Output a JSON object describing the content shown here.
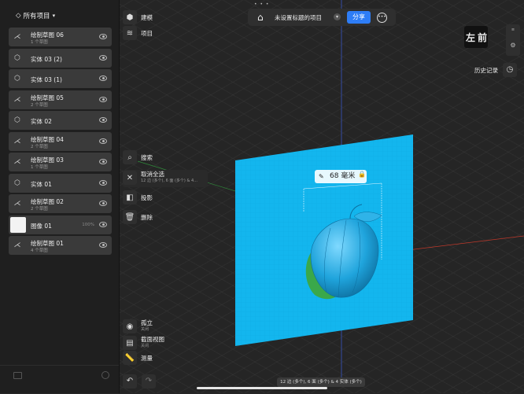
{
  "sidebar": {
    "header": "所有项目",
    "items": [
      {
        "type": "sketch",
        "name": "绘制草图 06",
        "sub": "1 个草图",
        "icon": "sketch-icon"
      },
      {
        "type": "solid",
        "name": "实体  03 (2)",
        "sub": "",
        "icon": "cube-icon"
      },
      {
        "type": "solid",
        "name": "实体  03 (1)",
        "sub": "",
        "icon": "cube-icon"
      },
      {
        "type": "sketch",
        "name": "绘制草图 05",
        "sub": "2 个草图",
        "icon": "sketch-icon"
      },
      {
        "type": "solid",
        "name": "实体  02",
        "sub": "",
        "icon": "cube-icon"
      },
      {
        "type": "sketch",
        "name": "绘制草图 04",
        "sub": "2 个草图",
        "icon": "sketch-icon"
      },
      {
        "type": "sketch",
        "name": "绘制草图 03",
        "sub": "1 个草图",
        "icon": "sketch-icon"
      },
      {
        "type": "solid",
        "name": "实体  01",
        "sub": "",
        "icon": "cube-icon"
      },
      {
        "type": "sketch",
        "name": "绘制草图 02",
        "sub": "2 个草图",
        "icon": "sketch-icon"
      },
      {
        "type": "image",
        "name": "图像 01",
        "sub": "",
        "pct": "100%",
        "icon": "image-thumb"
      },
      {
        "type": "sketch",
        "name": "绘制草图 01",
        "sub": "4 个草图",
        "icon": "sketch-icon"
      }
    ]
  },
  "toolbar": {
    "model": "建模",
    "project": "项目",
    "search": "搜索",
    "deselect": "取消全选",
    "deselect_sub": "12 边 (多个), 6 面 (多个) & 4...",
    "project_shadow": "投影",
    "delete": "删除",
    "isolate": "孤立",
    "isolate_sub": "关闭",
    "section": "截面视图",
    "section_sub": "关闭",
    "measure": "测量"
  },
  "topbar": {
    "title": "未设置标题的项目",
    "share": "分享"
  },
  "viewcube": {
    "left": "左",
    "front": "前"
  },
  "history": "历史记录",
  "dimension": "68 毫米",
  "status": "12 边 (多个), 6 面 (多个) & 4 实体 (多个)",
  "colors": {
    "plane": "#1ab4ec",
    "accent": "#2e7df6",
    "sidebar": "#1f1f1f"
  }
}
